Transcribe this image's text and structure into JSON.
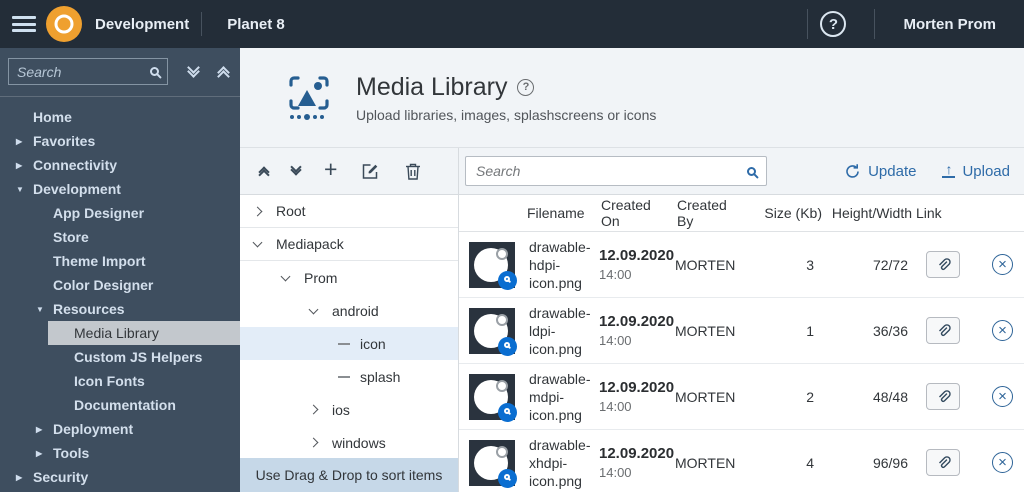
{
  "topbar": {
    "product": "Development",
    "app": "Planet 8",
    "help": "?",
    "user": "Morten Prom"
  },
  "sidebar": {
    "search_placeholder": "Search",
    "items": [
      {
        "label": "Home"
      },
      {
        "label": "Favorites"
      },
      {
        "label": "Connectivity"
      },
      {
        "label": "Development"
      },
      {
        "label": "App Designer"
      },
      {
        "label": "Store"
      },
      {
        "label": "Theme Import"
      },
      {
        "label": "Color Designer"
      },
      {
        "label": "Resources"
      },
      {
        "label": "Media Library"
      },
      {
        "label": "Custom JS Helpers"
      },
      {
        "label": "Icon Fonts"
      },
      {
        "label": "Documentation"
      },
      {
        "label": "Deployment"
      },
      {
        "label": "Tools"
      },
      {
        "label": "Security"
      }
    ]
  },
  "header": {
    "title": "Media Library",
    "help": "?",
    "subtitle": "Upload libraries, images, splashscreens or icons"
  },
  "toolbar": {
    "search_placeholder": "Search",
    "plus": "+",
    "update_label": "Update",
    "upload_label": "Upload",
    "upload_arrow": "↑"
  },
  "tree": {
    "nodes": [
      {
        "label": "Root"
      },
      {
        "label": "Mediapack"
      },
      {
        "label": "Prom"
      },
      {
        "label": "android"
      },
      {
        "label": "icon"
      },
      {
        "label": "splash"
      },
      {
        "label": "ios"
      },
      {
        "label": "windows"
      }
    ],
    "footer": "Use Drag & Drop to sort items"
  },
  "table": {
    "columns": [
      "Filename",
      "Created On",
      "Created By",
      "Size (Kb)",
      "Height/Width",
      "Link"
    ],
    "rows": [
      {
        "filename": "drawable-hdpi-icon.png",
        "created_date": "12.09.2020",
        "created_time": "14:00",
        "created_by": "MORTEN",
        "size_kb": "3",
        "height_width": "72/72"
      },
      {
        "filename": "drawable-ldpi-icon.png",
        "created_date": "12.09.2020",
        "created_time": "14:00",
        "created_by": "MORTEN",
        "size_kb": "1",
        "height_width": "36/36"
      },
      {
        "filename": "drawable-mdpi-icon.png",
        "created_date": "12.09.2020",
        "created_time": "14:00",
        "created_by": "MORTEN",
        "size_kb": "2",
        "height_width": "48/48"
      },
      {
        "filename": "drawable-xhdpi-icon.png",
        "created_date": "12.09.2020",
        "created_time": "14:00",
        "created_by": "MORTEN",
        "size_kb": "4",
        "height_width": "96/96"
      }
    ]
  },
  "colors": {
    "topbar_bg": "#232d38",
    "sidebar_bg": "#3e4e5f",
    "accent_blue": "#2e6ba8",
    "logo_orange": "#efa02f",
    "selected_nav_bg": "#c3c8cd",
    "tree_selected_bg": "#e3edf8",
    "tree_footer_bg": "#c6d8e8",
    "badge_blue": "#0a6ed1"
  }
}
